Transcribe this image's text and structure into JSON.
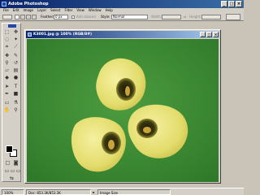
{
  "window": {
    "title": "Adobe Photoshop"
  },
  "menu": [
    "File",
    "Edit",
    "Image",
    "Layer",
    "Select",
    "Filter",
    "View",
    "Window",
    "Help"
  ],
  "options": {
    "feather_label": "Feather:",
    "feather_value": "0 px",
    "antialiased_label": "Anti-aliased",
    "style_label": "Style:",
    "style_value": "Normal",
    "width_label": "Width:",
    "height_label": "Height:"
  },
  "document": {
    "title": "K3001.jpg @ 100% (RGB/8#)"
  },
  "status": {
    "zoom": "100%",
    "doc_size": "Doc: 853.3K/853.3K",
    "info": "Image Size"
  },
  "colors": {
    "canvas_bg": "#3f8f35",
    "flower": "#e8e27a",
    "titlebar": "#0a246a"
  }
}
